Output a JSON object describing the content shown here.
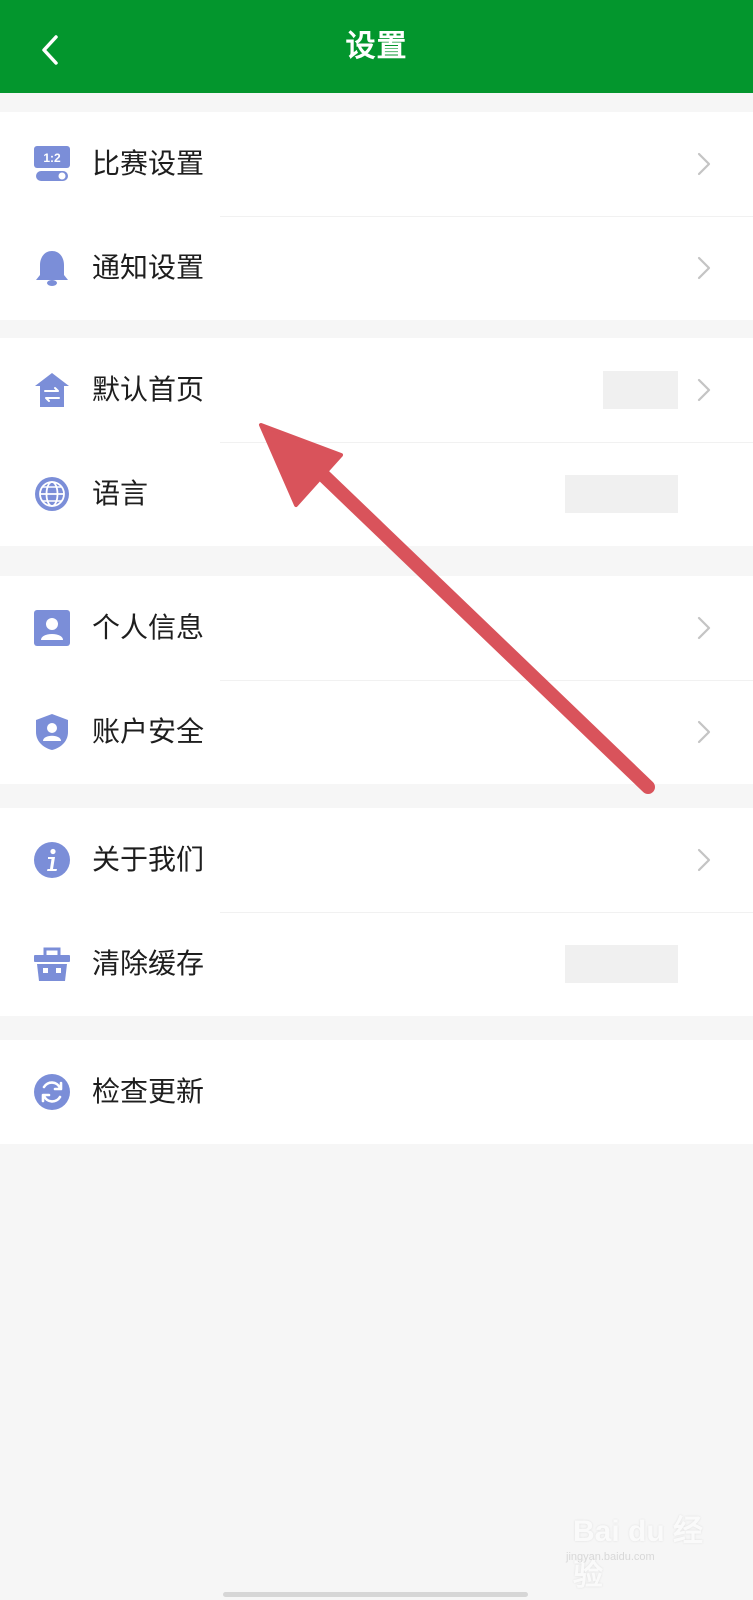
{
  "header": {
    "back_icon": "chevron-left-icon",
    "title": "设置",
    "background": "#03962d"
  },
  "groups": [
    {
      "items": [
        {
          "label": "比赛设置",
          "icon": "match-score-icon",
          "chevron": true
        },
        {
          "label": "通知设置",
          "icon": "bell-icon",
          "chevron": true
        }
      ]
    },
    {
      "items": [
        {
          "label": "默认首页",
          "icon": "home-switch-icon",
          "chevron": true,
          "value": ""
        },
        {
          "label": "语言",
          "icon": "globe-icon",
          "chevron": false,
          "value": ""
        }
      ]
    },
    {
      "items": [
        {
          "label": "个人信息",
          "icon": "person-card-icon",
          "chevron": true
        },
        {
          "label": "账户安全",
          "icon": "shield-user-icon",
          "chevron": true
        }
      ]
    },
    {
      "items": [
        {
          "label": "关于我们",
          "icon": "info-icon",
          "chevron": true
        },
        {
          "label": "清除缓存",
          "icon": "basket-icon",
          "chevron": false,
          "value": ""
        }
      ]
    },
    {
      "items": [
        {
          "label": "检查更新",
          "icon": "refresh-icon",
          "chevron": false
        }
      ]
    }
  ],
  "colors": {
    "icon": "#7b8ed8",
    "annotation_arrow": "#d9535b",
    "chevron": "#c4c4c4"
  },
  "watermark": {
    "brand": "Bai du 经验",
    "url": "jingyan.baidu.com"
  }
}
